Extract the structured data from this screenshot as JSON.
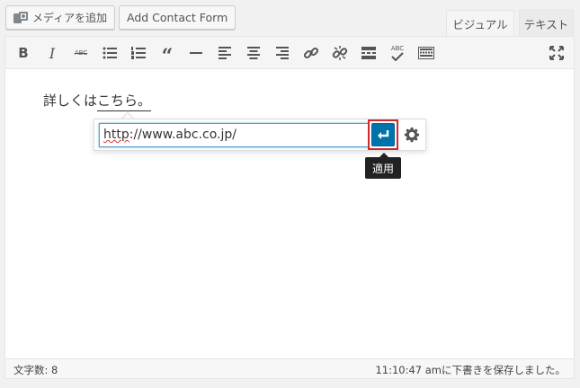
{
  "header": {
    "add_media_label": "メディアを追加",
    "contact_form_label": "Add Contact Form",
    "tabs": [
      {
        "label": "ビジュアル",
        "active": true
      },
      {
        "label": "テキスト",
        "active": false
      }
    ]
  },
  "toolbar": {
    "buttons": [
      {
        "name": "bold",
        "glyph": "B"
      },
      {
        "name": "italic",
        "glyph": "I"
      },
      {
        "name": "strikethrough",
        "glyph": "ABC"
      },
      {
        "name": "bullet-list"
      },
      {
        "name": "numbered-list"
      },
      {
        "name": "blockquote"
      },
      {
        "name": "horizontal-line"
      },
      {
        "name": "align-left"
      },
      {
        "name": "align-center"
      },
      {
        "name": "align-right"
      },
      {
        "name": "insert-link"
      },
      {
        "name": "remove-link"
      },
      {
        "name": "read-more"
      },
      {
        "name": "spellcheck",
        "glyph": "ABC"
      },
      {
        "name": "toolbar-toggle"
      },
      {
        "name": "fullscreen"
      }
    ]
  },
  "editor": {
    "text_before": "詳しくは",
    "linked_text": "こちら。",
    "link_url": "http://www.abc.co.jp/",
    "url_squiggle": "http",
    "url_rest": "://www.abc.co.jp/",
    "apply_tooltip": "適用"
  },
  "status": {
    "word_count": "文字数: 8",
    "autosave": "11:10:47 amに下書きを保存しました。"
  },
  "colors": {
    "accent": "#0073aa",
    "highlight": "#d02a2a"
  }
}
